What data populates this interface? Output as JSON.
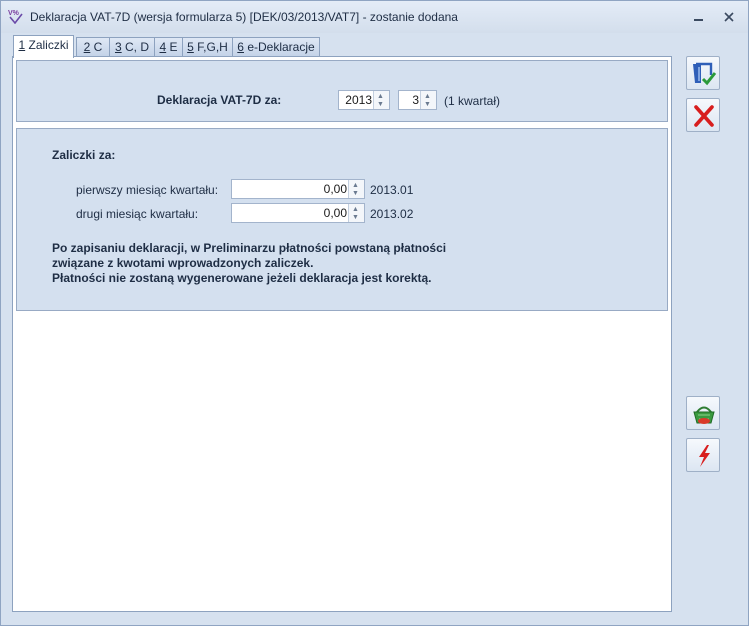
{
  "window": {
    "title": "Deklaracja VAT-7D (wersja formularza 5) [DEK/03/2013/VAT7] - zostanie dodana"
  },
  "tabs": [
    {
      "key": "1",
      "rest": " Zaliczki"
    },
    {
      "key": "2",
      "rest": " C"
    },
    {
      "key": "3",
      "rest": " C, D"
    },
    {
      "key": "4",
      "rest": " E"
    },
    {
      "key": "5",
      "rest": " F,G,H"
    },
    {
      "key": "6",
      "rest": " e-Deklaracje"
    }
  ],
  "header": {
    "label": "Deklaracja VAT-7D za:",
    "year": "2013",
    "quarter": "3",
    "quarter_note": "(1 kwartał)"
  },
  "advances": {
    "title": "Zaliczki za:",
    "rows": [
      {
        "label": "pierwszy miesiąc kwartału:",
        "value": "0,00",
        "period": "2013.01"
      },
      {
        "label": "drugi miesiąc kwartału:",
        "value": "0,00",
        "period": "2013.02"
      }
    ],
    "note_lines": [
      "Po zapisaniu deklaracji, w Preliminarzu płatności powstaną płatności",
      "związane z kwotami wprowadzonych zaliczek.",
      "Płatności nie zostaną wygenerowane jeżeli deklaracja jest korektą."
    ]
  },
  "icons": {
    "app": "vat-document-icon",
    "save": "save-floppy-icon",
    "cancel": "cancel-x-icon",
    "basket": "basket-icon",
    "lightning": "lightning-icon"
  },
  "colors": {
    "panel": "#d4e0ef",
    "cancel_red": "#d81e1e",
    "save_blue": "#2f5fb8"
  }
}
